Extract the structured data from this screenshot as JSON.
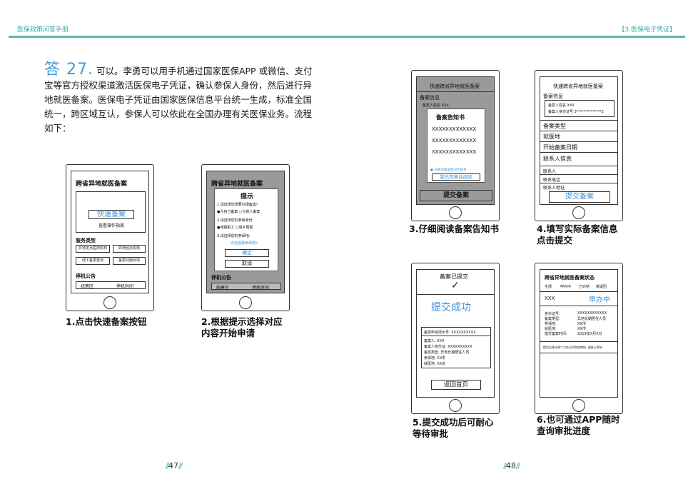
{
  "header": {
    "left": "医保政策问答手册",
    "right": "【3.医保电子凭证】"
  },
  "answer": {
    "label": "答 27.",
    "text": "可以。李勇可以用手机通过国家医保APP 或微信、支付宝等官方授权渠道激活医保电子凭证，确认参保人身份，然后进行异地就医备案。医保电子凭证由国家医保信息平台统一生成，标准全国统一，跨区域互认，参保人可以依此在全国办理有关医保业务。流程如下："
  },
  "steps": {
    "s1": {
      "caption_l1": "1.点击快速备案按钮",
      "title": "跨省异地就医备案",
      "quick": "快速备案",
      "guide": "查看操作指南",
      "service_type": "服务类型",
      "grid": [
        "异地定点医药机构",
        "异地经办机构",
        "线下备案查询",
        "备案问题反馈"
      ],
      "notice": "停机公告",
      "tbl": [
        "统筹区",
        "停机时间"
      ]
    },
    "s2": {
      "caption_l1": "2.根据提示选择对应",
      "caption_l2": "内容开始申请",
      "bg_title": "跨省异地就医备案",
      "dialog_title": "提示",
      "q1": "1.请选择您想要办理备案?",
      "q1_opts": "●为自己备案  ○为他人备案",
      "q2": "2.请选择您的参保身份:",
      "q2_opts": "●城镇职工    ○城乡居民",
      "q3": "3.请选择您的参保地:",
      "link": "点击选择参保地>",
      "confirm": "确定",
      "cancel": "取消",
      "notice": "停机公告",
      "tbl": [
        "统筹区",
        "停机时间"
      ]
    },
    "s3": {
      "caption_l1": "3.仔细阅读备案告知书",
      "title": "快速跨省异地就医备案",
      "info": "备案信息",
      "name_row": "备案人姓名    XXX",
      "dialog_title": "备案告知书",
      "lines": [
        "XXXXXXXXXXXXX",
        "XXXXXXXXXXXXX",
        "XXXXXXXXXXXXX"
      ],
      "check": "● 已阅读备案登记告知书",
      "agree": "我已同意并阅读",
      "submit": "提交备案"
    },
    "s4": {
      "caption_l1": "4.填写实际备案信息",
      "caption_l2": "点击提交",
      "title": "快速跨省异地就医备案",
      "info": "备案信息",
      "name_row": "备案人姓名      XXX",
      "id_row": "备案人身份证号 3**************2",
      "fields": [
        "备案类型",
        "就医地",
        "开始备案日期",
        "联系人信息"
      ],
      "contacts": [
        "联系人",
        "联系电话",
        "联系人地址"
      ],
      "submit": "提交备案"
    },
    "s5": {
      "caption_l1": "5.提交成功后可耐心",
      "caption_l2": "等待审批",
      "title": "备案已提交",
      "check": "✓",
      "success": "提交成功",
      "rows": [
        "备案申请流水号: XXXXXXXXXX",
        "备案人: XXX",
        "备案人身份证: XXXXXXXXXX",
        "备案类型: 异地长期居住人员",
        "参保地: XX市",
        "就医地: XX省"
      ],
      "back": "返回首页"
    },
    "s6": {
      "caption_l1": "6.也可通过APP随时",
      "caption_l2": "查询审批进度",
      "title": "跨省异地就医备案状态",
      "tabs": [
        "全部",
        "申办中",
        "已办结",
        "被退回"
      ],
      "name": "XXX",
      "status": "申办中",
      "rows": [
        [
          "身份证号:",
          "XXXXXXXXXXXX"
        ],
        [
          "备案类型:",
          "异地长期居住人员"
        ],
        [
          "参保地:",
          "XX市"
        ],
        [
          "就医地:",
          "XX市"
        ],
        [
          "提交备案时间:",
          "2019年X月X日"
        ]
      ],
      "note": "提交后预计两个工作日内完成审核, 请耐心等待"
    }
  },
  "pages": {
    "left": "47",
    "right": "48"
  }
}
